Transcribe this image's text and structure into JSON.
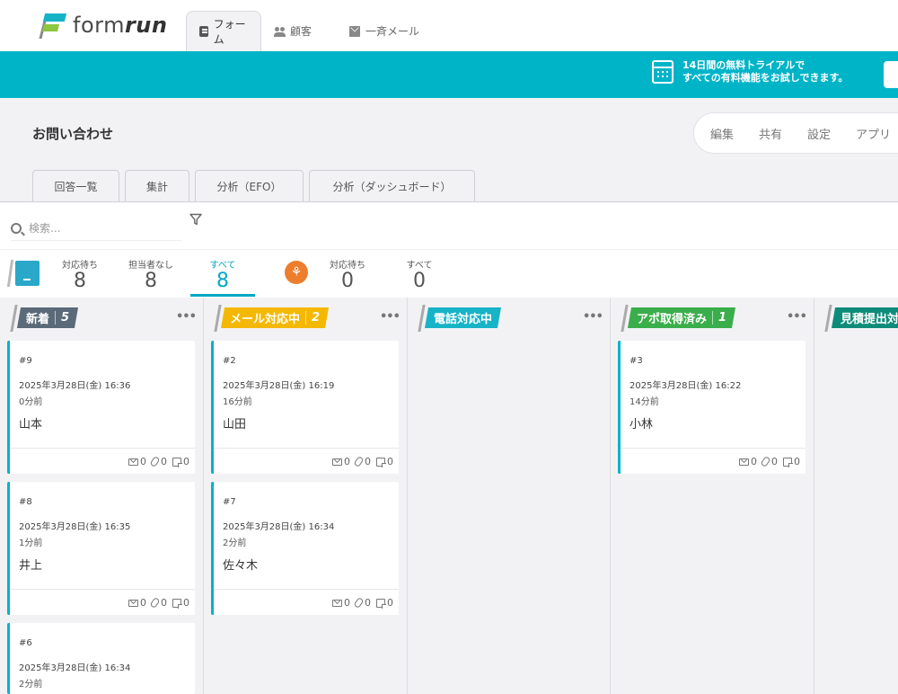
{
  "app": {
    "logo_text_light": "form",
    "logo_text_bold": "run"
  },
  "top_tabs": [
    {
      "label": "フォーム",
      "icon": "form-icon",
      "active": true
    },
    {
      "label": "顧客",
      "icon": "users-icon",
      "active": false
    },
    {
      "label": "一斉メール",
      "icon": "mail-icon",
      "active": false
    }
  ],
  "banner": {
    "line1": "14日間の無料トライアルで",
    "line2": "すべての有料機能をお試しできます。",
    "icon": "calendar-icon",
    "color": "#00b4c8"
  },
  "form": {
    "title": "お問い合わせ",
    "actions": [
      "編集",
      "共有",
      "設定",
      "アプリ"
    ]
  },
  "sub_tabs": [
    "回答一覧",
    "集計",
    "分析（EFO）",
    "分析（ダッシュボード）"
  ],
  "search": {
    "placeholder": "検索..."
  },
  "stats": {
    "group1": [
      {
        "label": "対応待ち",
        "value": "8"
      },
      {
        "label": "担当者なし",
        "value": "8"
      },
      {
        "label": "すべて",
        "value": "8",
        "active": true
      }
    ],
    "group2": [
      {
        "label": "対応待ち",
        "value": "0"
      },
      {
        "label": "すべて",
        "value": "0"
      }
    ]
  },
  "columns": [
    {
      "label": "新着",
      "count": "5",
      "color": "#5a6a78",
      "cards": [
        {
          "no": "#9",
          "date": "2025年3月28日(金) 16:36",
          "ago": "0分前",
          "name": "山本",
          "mails": "0",
          "files": "0",
          "memos": "0"
        },
        {
          "no": "#8",
          "date": "2025年3月28日(金) 16:35",
          "ago": "1分前",
          "name": "井上",
          "mails": "0",
          "files": "0",
          "memos": "0"
        },
        {
          "no": "#6",
          "date": "2025年3月28日(金) 16:34",
          "ago": "2分前"
        }
      ]
    },
    {
      "label": "メール対応中",
      "count": "2",
      "color": "#f5b800",
      "cards": [
        {
          "no": "#2",
          "date": "2025年3月28日(金) 16:19",
          "ago": "16分前",
          "name": "山田",
          "mails": "0",
          "files": "0",
          "memos": "0"
        },
        {
          "no": "#7",
          "date": "2025年3月28日(金) 16:34",
          "ago": "2分前",
          "name": "佐々木",
          "mails": "0",
          "files": "0",
          "memos": "0"
        }
      ]
    },
    {
      "label": "電話対応中",
      "count": "",
      "color": "#17b3c7",
      "cards": []
    },
    {
      "label": "アポ取得済み",
      "count": "1",
      "color": "#3aae4a",
      "cards": [
        {
          "no": "#3",
          "date": "2025年3月28日(金) 16:22",
          "ago": "14分前",
          "name": "小林",
          "mails": "0",
          "files": "0",
          "memos": "0"
        }
      ]
    },
    {
      "label": "見積提出対",
      "count": "",
      "color": "#0e8c7a",
      "cards": []
    }
  ],
  "more_label": "•••"
}
